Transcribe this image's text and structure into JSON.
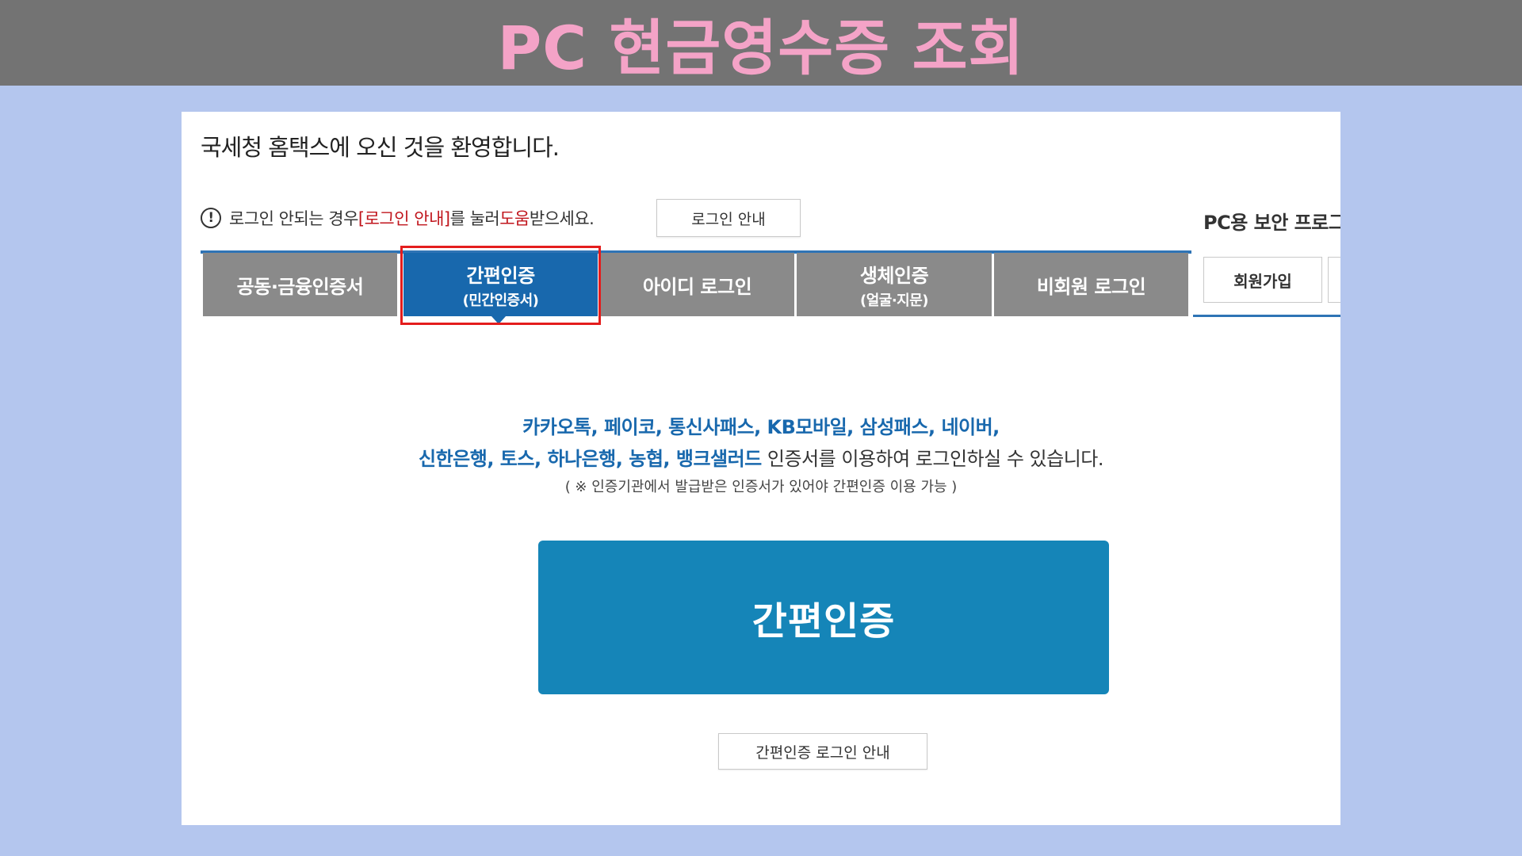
{
  "banner": {
    "title": "PC 현금영수증 조회"
  },
  "panel": {
    "welcome": "국세청 홈택스에 오신 것을 환영합니다.",
    "notice": {
      "part1": "로그인 안되는 경우 ",
      "link": "[로그인 안내]",
      "part2": "를 눌러 ",
      "help": "도움",
      "part3": "받으세요."
    },
    "login_guide_button": "로그인 안내",
    "security_program": "PC용 보안 프로그",
    "tabs": [
      {
        "label": "공동·금융인증서",
        "sub": ""
      },
      {
        "label": "간편인증",
        "sub": "(민간인증서)"
      },
      {
        "label": "아이디 로그인",
        "sub": ""
      },
      {
        "label": "생체인증",
        "sub": "(얼굴·지문)"
      },
      {
        "label": "비회원 로그인",
        "sub": ""
      }
    ],
    "join_button": "회원가입",
    "description": {
      "line1": "카카오톡, 페이코, 통신사패스, KB모바일, 삼성패스, 네이버,",
      "line2_blue": "신한은행, 토스, 하나은행, 농협, 뱅크샐러드",
      "line2_plain": " 인증서를 이용하여 로그인하실 수 있습니다.",
      "line3": "( ※ 인증기관에서 발급받은 인증서가 있어야 간편인증 이용 가능 )"
    },
    "main_button": "간편인증",
    "sub_button": "간편인증 로그인 안내"
  },
  "colors": {
    "active_tab": "#1868ad",
    "inactive_tab": "#8a8a8a",
    "main_button": "#1585b8",
    "highlight": "#e41d1d"
  }
}
